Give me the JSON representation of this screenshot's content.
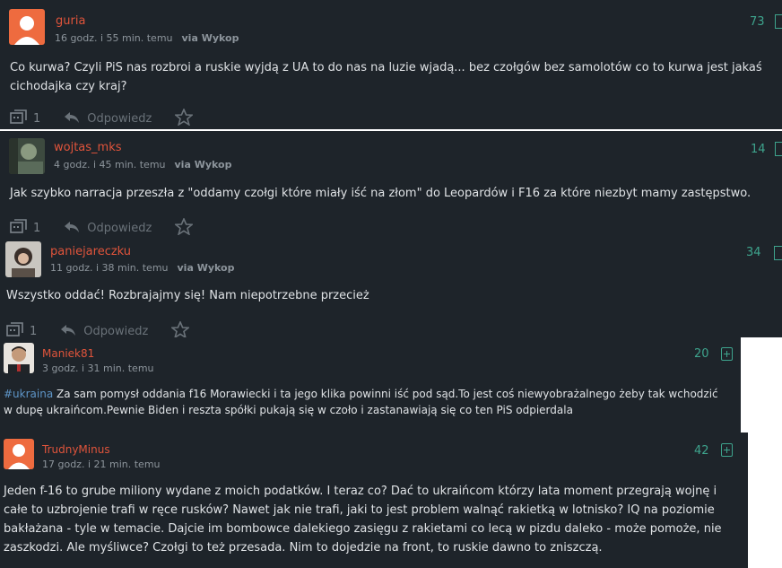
{
  "comments": [
    {
      "username": "guria",
      "time": "16 godz. i 55 min. temu",
      "via": "via Wykop",
      "score": "73",
      "text": "Co kurwa? Czyli PiS nas rozbroi a ruskie wyjdą z UA to do nas na luzie wjadą... bez czołgów bez samolotów co to kurwa jest jakaś cichodajka czy kraj?",
      "reply_count": "1",
      "reply_label": "Odpowiedz"
    },
    {
      "username": "wojtas_mks",
      "time": "4 godz. i 45 min. temu",
      "via": "via Wykop",
      "score": "14",
      "text": "Jak szybko narracja przeszła z \"oddamy czołgi które miały iść na złom\" do Leopardów i F16 za które niezbyt mamy zastępstwo.",
      "reply_count": "1",
      "reply_label": "Odpowiedz"
    },
    {
      "username": "paniejareczku",
      "time": "11 godz. i 38 min. temu",
      "via": "via Wykop",
      "score": "34",
      "text": "Wszystko oddać! Rozbrajajmy się! Nam niepotrzebne przecież",
      "reply_count": "1",
      "reply_label": "Odpowiedz"
    },
    {
      "username": "Maniek81",
      "time": "3 godz. i 31 min. temu",
      "score": "20",
      "tag": "#ukraina",
      "text": " Za sam pomysł oddania f16 Morawiecki i ta jego klika powinni iść pod sąd.To jest coś niewyobrażalnego żeby tak wchodzić w dupę ukraińcom.Pewnie Biden i reszta spółki pukają się w czoło i zastanawiają się co ten PiS odpierdala"
    },
    {
      "username": "TrudnyMinus",
      "time": "17 godz. i 21 min. temu",
      "score": "42",
      "text": "Jeden f-16 to grube miliony wydane z moich podatków. I teraz co? Dać to ukraińcom którzy lata moment przegrają wojnę i całe to uzbrojenie trafi w ręce rusków? Nawet jak nie trafi, jaki to jest problem walnąć rakietką w lotnisko? IQ na poziomie bakłażana - tyle w temacie. Dajcie im bombowce dalekiego zasięgu z rakietami co lecą w pizdu daleko - może pomoże, nie zaszkodzi. Ale myśliwce? Czołgi to też przesada. Nim to dojedzie na front, to ruskie dawno to zniszczą."
    }
  ],
  "icons": {
    "comment": "comment-icon",
    "reply": "reply-arrow-icon",
    "star": "star-icon",
    "plus": "plus-icon",
    "minus": "minus-icon"
  },
  "colors": {
    "background": "#1e242a",
    "username": "#e0543b",
    "score": "#3ea48d",
    "text": "#dfe2e5",
    "meta": "#8d959c",
    "tag": "#5e95c7"
  }
}
